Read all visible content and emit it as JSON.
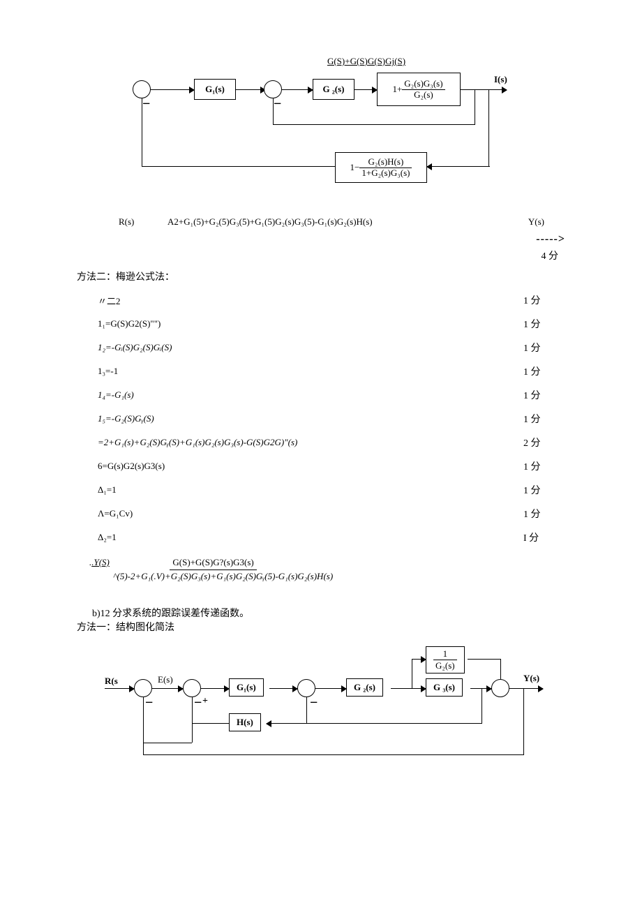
{
  "eqTop": "G(S)+G(S)G(S)Gj(S)",
  "diagram1": {
    "g1": "G₁(s)",
    "g2": "G ₂(s)",
    "box3_pre": "1+",
    "box3_num": "G₂(s)G₃(s)",
    "box3_den": "G₂(s)",
    "fb_pre": "1−",
    "fb_num": "G₂(s)H(s)",
    "fb_den": "1+G₂(s)G₃(s)",
    "ys": "I(s)"
  },
  "tf": {
    "r": "R(s)",
    "center": "A2+G₁(5)+G₂(5)G₃(5)+G₁(5)G₂(s)G₃(5)-G₁(s)G₂(s)H(s)",
    "y": "Y(s)",
    "arrow": "----->"
  },
  "score4": "4 分",
  "method2_title": "方法二：梅逊公式法：",
  "steps": [
    {
      "c": "〃二2",
      "s": "1 分",
      "italic": false
    },
    {
      "c": "1₁=G(S)G2(S)\"\")",
      "s": "1 分",
      "italic": false
    },
    {
      "c": "1₂=-Gᵢ(S)G₂(S)Gᵢ(S)",
      "s": "1 分",
      "italic": true
    },
    {
      "c": "1₃=-1",
      "s": "1 分",
      "italic": false
    },
    {
      "c": "1₄=-G₁(s)",
      "s": "1 分",
      "italic": true
    },
    {
      "c": "1₅=-G₂(S)Gᵧ(S)",
      "s": "1 分",
      "italic": true
    },
    {
      "c": "  =2+G₁(s)+G₂(S)Gᵧ(S)+G₁(s)G₂(s)G₃(s)-G(S)G2G)\"(s)",
      "s": "2 分",
      "italic": true
    },
    {
      "c": "6=G(s)G2(s)G3(s)",
      "s": "1 分",
      "italic": false
    },
    {
      "c": "Δ₁=1",
      "s": "1 分",
      "italic": false
    },
    {
      "c": "Λ=G₁Cv)",
      "s": "1 分",
      "italic": false
    },
    {
      "c": "Δ₂=1",
      "s": "I 分",
      "italic": false
    }
  ],
  "final": {
    "left": ".Y(S)",
    "top": "G(S)+G(S)G?(s)G3(s)",
    "bot": "^(5)-2+G₁(.V)+G₂(S)G₃(s)+G₁(s)G₂(S)Gᵧ(5)-G₁(s)G₂(s)H(s)"
  },
  "sectionB": {
    "header": "b)12 分求系统的跟踪误差传递函数。",
    "method1": "方法一：结构图化简法"
  },
  "diagram2": {
    "rs": "R(s",
    "es": "E(s)",
    "g1": "G₁(s)",
    "g2": "G ₂(s)",
    "g3": "G ₃(s)",
    "hs": "H(s)",
    "inv_num": "1",
    "inv_den": "G₂(s)",
    "ys": "Y(s)"
  }
}
